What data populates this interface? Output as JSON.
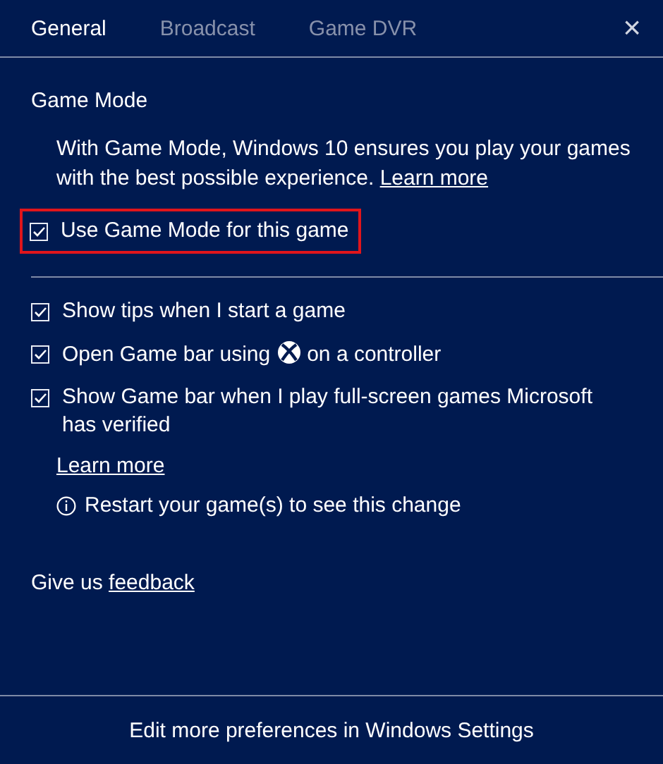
{
  "tabs": [
    {
      "label": "General",
      "selected": true
    },
    {
      "label": "Broadcast",
      "selected": false
    },
    {
      "label": "Game DVR",
      "selected": false
    }
  ],
  "close_button": "×",
  "game_mode": {
    "heading": "Game Mode",
    "description": "With Game Mode, Windows 10 ensures you play your games with the best possible experience.",
    "link": "Learn more",
    "option": {
      "label": "Use Game Mode for this game",
      "checked": true,
      "highlighted": true
    }
  },
  "options": [
    {
      "kind": "plain",
      "label": "Show tips when I start a game",
      "checked": true
    },
    {
      "kind": "icon",
      "label": "Open Game bar using",
      "label_after": "on a controller",
      "checked": true
    },
    {
      "kind": "plain",
      "label": "Show Game bar when I play full-screen games Microsoft has verified",
      "checked": true
    }
  ],
  "learn_more": "Learn more",
  "notice": "Restart your game(s) to see this change",
  "feedback": {
    "text": "Give us",
    "link": "feedback"
  },
  "footer_button": "Edit more preferences in Windows Settings"
}
